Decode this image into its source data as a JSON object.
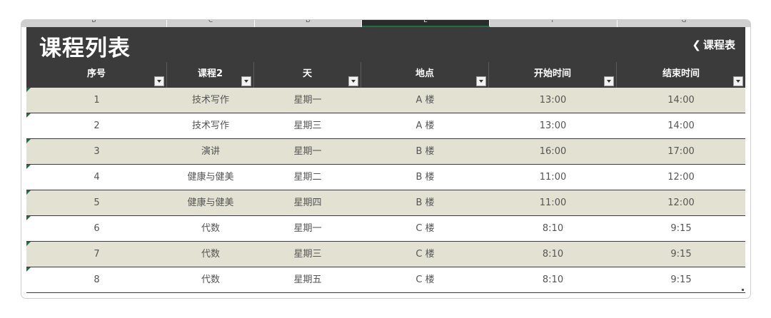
{
  "column_letters": [
    "B",
    "C",
    "D",
    "E",
    "F",
    "G"
  ],
  "title": "课程列表",
  "back_link": {
    "chevron": "❮",
    "label": "课程表"
  },
  "headers": [
    "序号",
    "课程2",
    "天",
    "地点",
    "开始时间",
    "结束时间"
  ],
  "rows": [
    [
      "1",
      "技术写作",
      "星期一",
      "A 楼",
      "13:00",
      "14:00"
    ],
    [
      "2",
      "技术写作",
      "星期三",
      "A 楼",
      "13:00",
      "14:00"
    ],
    [
      "3",
      "演讲",
      "星期一",
      "B 楼",
      "16:00",
      "17:00"
    ],
    [
      "4",
      "健康与健美",
      "星期二",
      "B 楼",
      "11:00",
      "12:00"
    ],
    [
      "5",
      "健康与健美",
      "星期四",
      "B 楼",
      "11:00",
      "12:00"
    ],
    [
      "6",
      "代数",
      "星期一",
      "C 楼",
      "8:10",
      "9:15"
    ],
    [
      "7",
      "代数",
      "星期三",
      "C 楼",
      "8:10",
      "9:15"
    ],
    [
      "8",
      "代数",
      "星期五",
      "C 楼",
      "8:10",
      "9:15"
    ]
  ],
  "colors": {
    "header_bg": "#3b3b3b",
    "band_row": "#e3e1d1",
    "indicator": "#1e7145"
  }
}
